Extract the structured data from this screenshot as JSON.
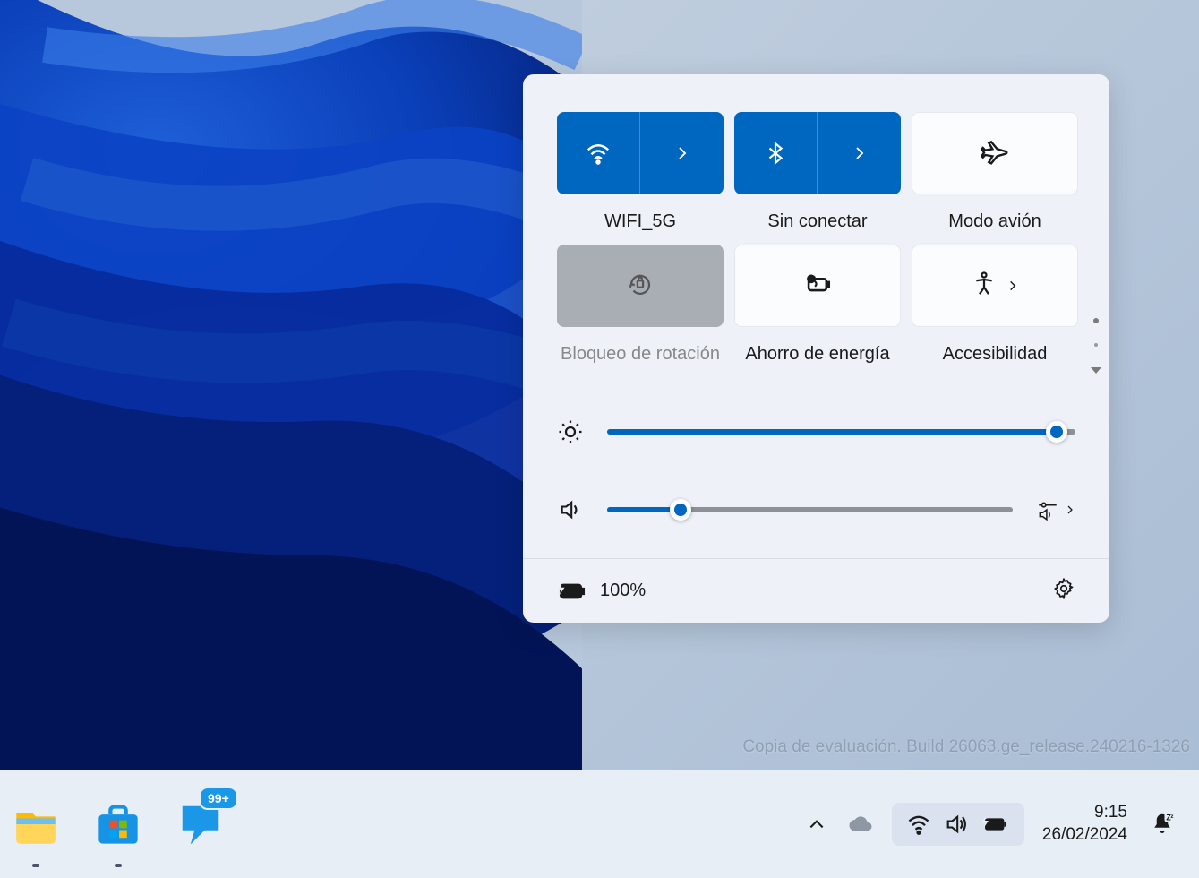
{
  "quick_settings": {
    "tiles": [
      {
        "label": "WIFI_5G"
      },
      {
        "label": "Sin conectar"
      },
      {
        "label": "Modo avión"
      },
      {
        "label": "Bloqueo de rotación"
      },
      {
        "label": "Ahorro de energía"
      },
      {
        "label": "Accesibilidad"
      }
    ],
    "brightness_pct": 96,
    "volume_pct": 18,
    "battery_label": "100%"
  },
  "watermark": "Copia de evaluación. Build 26063.ge_release.240216-1326",
  "taskbar": {
    "tips_badge": "99+",
    "time": "9:15",
    "date": "26/02/2024"
  }
}
